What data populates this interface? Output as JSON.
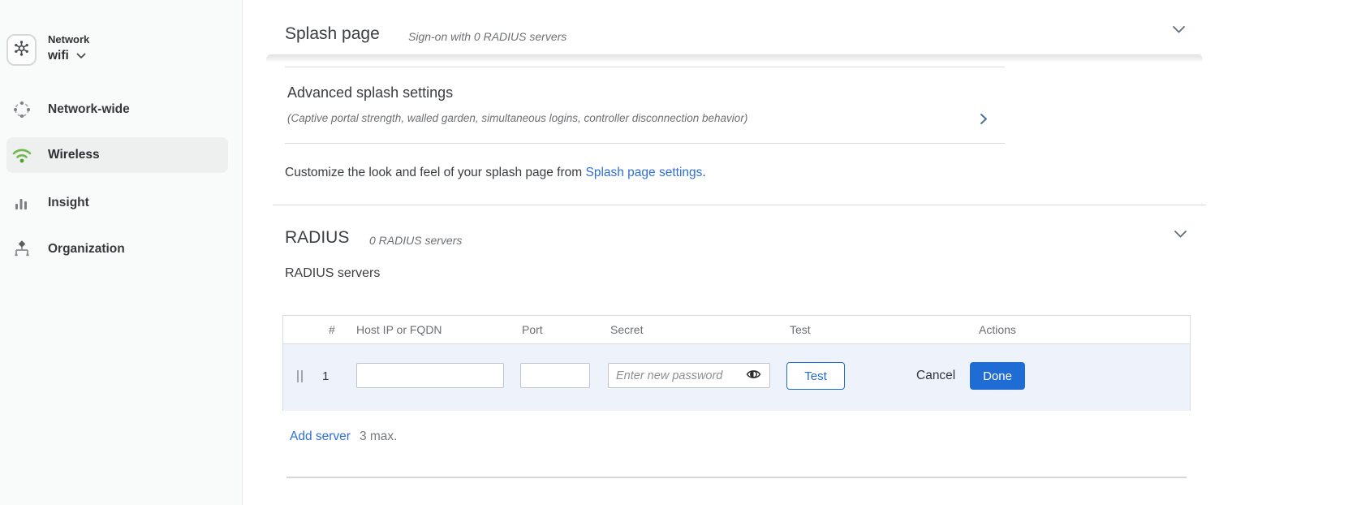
{
  "sidebar": {
    "network_label": "Network",
    "network_value": "wifi",
    "items": [
      {
        "label": "Network-wide",
        "icon": "network-wide-icon",
        "active": false
      },
      {
        "label": "Wireless",
        "icon": "wireless-icon",
        "active": true
      },
      {
        "label": "Insight",
        "icon": "insight-icon",
        "active": false
      },
      {
        "label": "Organization",
        "icon": "organization-icon",
        "active": false
      }
    ]
  },
  "splash_section": {
    "title": "Splash page",
    "subtitle": "Sign-on with 0 RADIUS servers",
    "advanced": {
      "title": "Advanced splash settings",
      "description": "(Captive portal strength, walled garden, simultaneous logins, controller disconnection behavior)"
    },
    "customize_text": "Customize the look and feel of your splash page from ",
    "customize_link": "Splash page settings",
    "customize_suffix": "."
  },
  "radius_section": {
    "title": "RADIUS",
    "subtitle": "0 RADIUS servers",
    "servers_label": "RADIUS servers",
    "table": {
      "headers": [
        "#",
        "Host IP or FQDN",
        "Port",
        "Secret",
        "Test",
        "Actions"
      ],
      "rows": [
        {
          "number": "1",
          "host_value": "",
          "port_value": "",
          "secret_placeholder": "Enter new password",
          "test_label": "Test",
          "cancel_label": "Cancel",
          "done_label": "Done"
        }
      ]
    },
    "add_server_label": "Add server",
    "max_label": "3 max."
  },
  "colors": {
    "accent_blue": "#1f6cd5",
    "link_blue": "#2f6fd6",
    "wireless_green": "#6cb34d",
    "row_highlight": "#eef3fb",
    "border_gray": "#d9dadb",
    "sidebar_bg": "#f9fafa"
  }
}
